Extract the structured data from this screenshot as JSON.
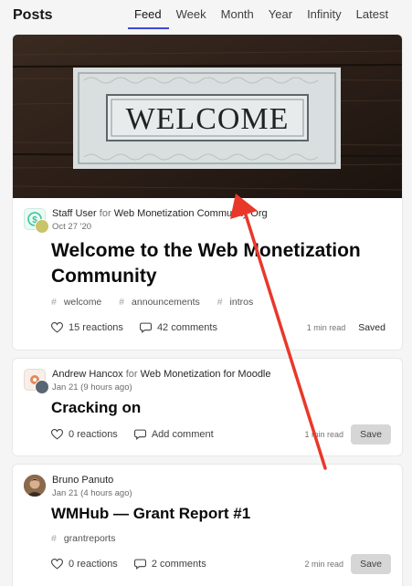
{
  "header": {
    "title": "Posts",
    "tabs": [
      {
        "label": "Feed",
        "active": true
      },
      {
        "label": "Week",
        "active": false
      },
      {
        "label": "Month",
        "active": false
      },
      {
        "label": "Year",
        "active": false
      },
      {
        "label": "Infinity",
        "active": false
      },
      {
        "label": "Latest",
        "active": false
      }
    ]
  },
  "posts": [
    {
      "cover_text": "WELCOME",
      "author": "Staff User",
      "for_word": "for",
      "org": "Web Monetization Community Org",
      "date": "Oct 27 '20",
      "title_line1": "Welcome to the Web Monetization",
      "title_line2": "Community",
      "tags": [
        "welcome",
        "announcements",
        "intros"
      ],
      "reactions": "15 reactions",
      "comments": "42 comments",
      "read_time": "1 min read",
      "save_label": "Saved"
    },
    {
      "author": "Andrew Hancox",
      "for_word": "for",
      "org": "Web Monetization for Moodle",
      "date": "Jan 21 (9 hours ago)",
      "title": "Cracking on",
      "reactions": "0 reactions",
      "comments": "Add comment",
      "read_time": "1 min read",
      "save_label": "Save"
    },
    {
      "author": "Bruno Panuto",
      "date": "Jan 21 (4 hours ago)",
      "title": "WMHub — Grant Report #1",
      "tags": [
        "grantreports"
      ],
      "reactions": "0 reactions",
      "comments": "2 comments",
      "read_time": "2 min read",
      "save_label": "Save"
    }
  ],
  "tag_prefix": "#",
  "colors": {
    "accent": "#3b49df",
    "annotation_arrow": "#e8382a",
    "save_button_bg": "#d6d6d6"
  },
  "icons": {
    "reactions": "heart-icon",
    "comments": "comment-icon",
    "org_logo": "dollar-icon"
  }
}
